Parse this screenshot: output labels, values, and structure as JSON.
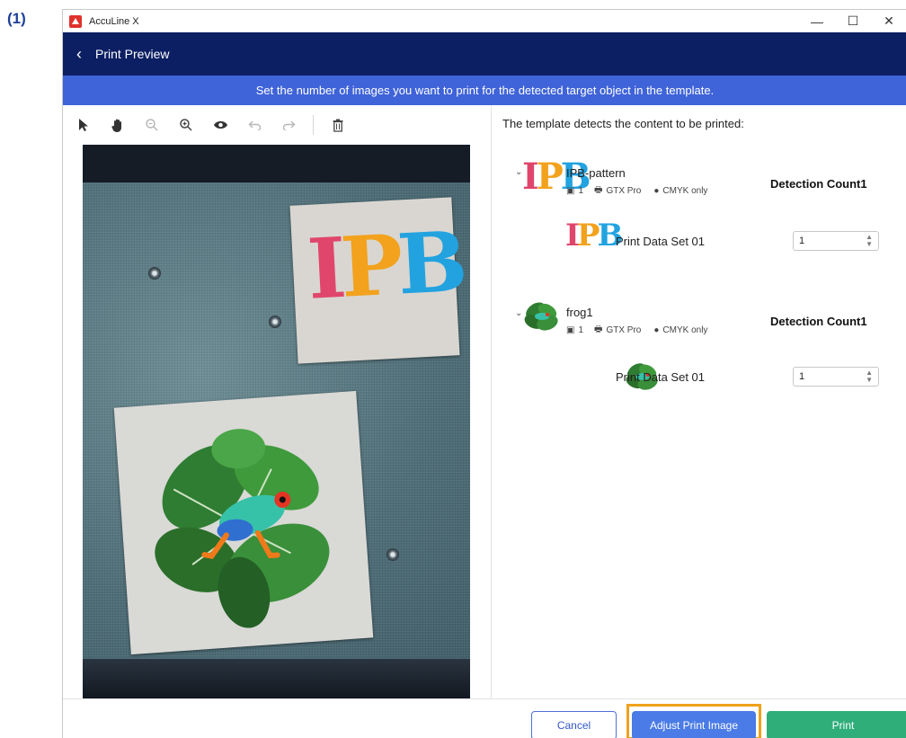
{
  "figure_label": "(1)",
  "window": {
    "app_title": "AccuLine X",
    "controls": {
      "minimize": "—",
      "maximize": "☐",
      "close": "✕"
    }
  },
  "header": {
    "back_icon": "‹",
    "title": "Print Preview"
  },
  "banner": {
    "text": "Set the number of images you want to print for the detected target object in the template."
  },
  "toolbar": {
    "tools": [
      "select-arrow-icon",
      "pan-hand-icon",
      "zoom-out-icon",
      "zoom-in-icon",
      "eye-icon",
      "undo-icon",
      "redo-icon",
      "delete-icon"
    ]
  },
  "preview": {
    "sheet1_text": "IPB",
    "colors": {
      "i": "#e0466b",
      "p": "#f2a21d",
      "b": "#22a3e0"
    }
  },
  "right": {
    "heading": "The template detects the content to be printed:",
    "groups": [
      {
        "name": "IPB-pattern",
        "thumb_text": "IPB",
        "meta_count": "1",
        "meta_printer": "GTX Pro",
        "meta_ink": "CMYK only",
        "detection_label": "Detection Count",
        "detection_count": "1",
        "data_set_label": "Print Data Set 01",
        "quantity": "1"
      },
      {
        "name": "frog1",
        "meta_count": "1",
        "meta_printer": "GTX Pro",
        "meta_ink": "CMYK only",
        "detection_label": "Detection Count",
        "detection_count": "1",
        "data_set_label": "Print Data Set 01",
        "quantity": "1"
      }
    ]
  },
  "footer": {
    "cancel_label": "Cancel",
    "adjust_label": "Adjust Print Image",
    "print_label": "Print"
  }
}
